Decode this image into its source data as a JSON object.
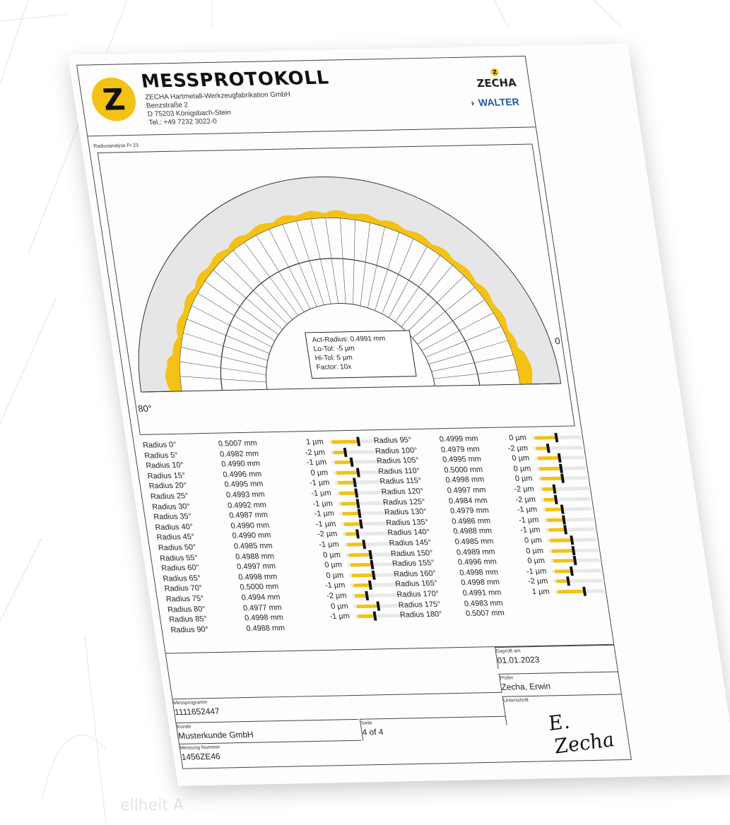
{
  "header": {
    "title": "MESSPROTOKOLL",
    "logo_letter": "Z",
    "company": "ZECHA Hartmetall-Werkzeugfabrikation GmbH",
    "street": "Benzstraße 2",
    "city": "D 75203 Königsbach-Stein",
    "phone": "Tel.: +49 7232 3022-0",
    "brand_zecha": "ZECHA",
    "brand_zecha_mark": "Z",
    "brand_walter": "WALTER"
  },
  "section_label": "Radiusanalyse Fr 23",
  "chart": {
    "deg_left": "80°",
    "deg_right": "0",
    "info": {
      "act_radius": "Act-Radius: 0.4991 mm",
      "lo_tol": "Lo-Tol: -5 µm",
      "hi_tol": "Hi-Tol: 5 µm",
      "factor": "Factor: 10x"
    },
    "colors": {
      "fill": "#f3c214",
      "band": "#e6e6e6",
      "line": "#333333"
    }
  },
  "radius_rows_left": [
    {
      "label": "Radius 0°",
      "value": "0.5007 mm",
      "dev": "1 µm",
      "dev_num": 1
    },
    {
      "label": "Radius 5°",
      "value": "0.4982 mm",
      "dev": "-2 µm",
      "dev_num": -2
    },
    {
      "label": "Radius 10°",
      "value": "0.4990 mm",
      "dev": "-1 µm",
      "dev_num": -1
    },
    {
      "label": "Radius 15°",
      "value": "0.4996 mm",
      "dev": "0 µm",
      "dev_num": 0
    },
    {
      "label": "Radius 20°",
      "value": "0.4995 mm",
      "dev": "-1 µm",
      "dev_num": -1
    },
    {
      "label": "Radius 25°",
      "value": "0.4993 mm",
      "dev": "-1 µm",
      "dev_num": -1
    },
    {
      "label": "Radius 30°",
      "value": "0.4992 mm",
      "dev": "-1 µm",
      "dev_num": -1
    },
    {
      "label": "Radius 35°",
      "value": "0.4987 mm",
      "dev": "-1 µm",
      "dev_num": -1
    },
    {
      "label": "Radius 40°",
      "value": "0.4990 mm",
      "dev": "-1 µm",
      "dev_num": -1
    },
    {
      "label": "Radius 45°",
      "value": "0.4990 mm",
      "dev": "-2 µm",
      "dev_num": -2
    },
    {
      "label": "Radius 50°",
      "value": "0.4985 mm",
      "dev": "-1 µm",
      "dev_num": -1
    },
    {
      "label": "Radius 55°",
      "value": "0.4988 mm",
      "dev": "0 µm",
      "dev_num": 0
    },
    {
      "label": "Radius 60°",
      "value": "0.4997 mm",
      "dev": "0 µm",
      "dev_num": 0
    },
    {
      "label": "Radius 65°",
      "value": "0.4998 mm",
      "dev": "0 µm",
      "dev_num": 0
    },
    {
      "label": "Radius 70°",
      "value": "0.5000 mm",
      "dev": "-1 µm",
      "dev_num": -1
    },
    {
      "label": "Radius 75°",
      "value": "0.4994 mm",
      "dev": "-2 µm",
      "dev_num": -2
    },
    {
      "label": "Radius 80°",
      "value": "0.4977 mm",
      "dev": "0 µm",
      "dev_num": 0
    },
    {
      "label": "Radius 85°",
      "value": "0.4998 mm",
      "dev": "-1 µm",
      "dev_num": -1
    },
    {
      "label": "Radius 90°",
      "value": "0.4988 mm",
      "dev": "",
      "dev_num": null
    }
  ],
  "radius_rows_right": [
    {
      "label": "Radius 95°",
      "value": "0.4999 mm",
      "dev": "0 µm",
      "dev_num": 0
    },
    {
      "label": "Radius 100°",
      "value": "0.4979 mm",
      "dev": "-2 µm",
      "dev_num": -2
    },
    {
      "label": "Radius 105°",
      "value": "0.4995 mm",
      "dev": "0 µm",
      "dev_num": 0
    },
    {
      "label": "Radius 110°",
      "value": "0.5000 mm",
      "dev": "0 µm",
      "dev_num": 0
    },
    {
      "label": "Radius 115°",
      "value": "0.4998 mm",
      "dev": "0 µm",
      "dev_num": 0
    },
    {
      "label": "Radius 120°",
      "value": "0.4997 mm",
      "dev": "-2 µm",
      "dev_num": -2
    },
    {
      "label": "Radius 125°",
      "value": "0.4984 mm",
      "dev": "-2 µm",
      "dev_num": -2
    },
    {
      "label": "Radius 130°",
      "value": "0.4979 mm",
      "dev": "-1 µm",
      "dev_num": -1
    },
    {
      "label": "Radius 135°",
      "value": "0.4986 mm",
      "dev": "-1 µm",
      "dev_num": -1
    },
    {
      "label": "Radius 140°",
      "value": "0.4988 mm",
      "dev": "-1 µm",
      "dev_num": -1
    },
    {
      "label": "Radius 145°",
      "value": "0.4985 mm",
      "dev": "0 µm",
      "dev_num": 0
    },
    {
      "label": "Radius 150°",
      "value": "0.4989 mm",
      "dev": "0 µm",
      "dev_num": 0
    },
    {
      "label": "Radius 155°",
      "value": "0.4996 mm",
      "dev": "0 µm",
      "dev_num": 0
    },
    {
      "label": "Radius 160°",
      "value": "0.4998 mm",
      "dev": "-1 µm",
      "dev_num": -1
    },
    {
      "label": "Radius 165°",
      "value": "0.4998 mm",
      "dev": "-2 µm",
      "dev_num": -2
    },
    {
      "label": "Radius 170°",
      "value": "0.4991 mm",
      "dev": "1 µm",
      "dev_num": 1
    },
    {
      "label": "Radius 175°",
      "value": "0.4983 mm",
      "dev": "",
      "dev_num": null
    },
    {
      "label": "Radius 180°",
      "value": "0.5007 mm",
      "dev": "",
      "dev_num": null
    }
  ],
  "footer": {
    "checked_on_label": "Geprüft am",
    "checked_on": "01.01.2023",
    "inspector_label": "Prüfer",
    "inspector": "Zecha, Erwin",
    "signature_label": "Unterschrift",
    "signature": "E. Zecha",
    "program_label": "Messprogramm",
    "program": "1111652447",
    "customer_label": "Kunde",
    "customer": "Musterkunde GmbH",
    "page_label": "Seite",
    "page": "4 of 4",
    "measurement_label": "Messung Nummer",
    "measurement": "1456ZE46"
  },
  "background_text": "ellheit A"
}
